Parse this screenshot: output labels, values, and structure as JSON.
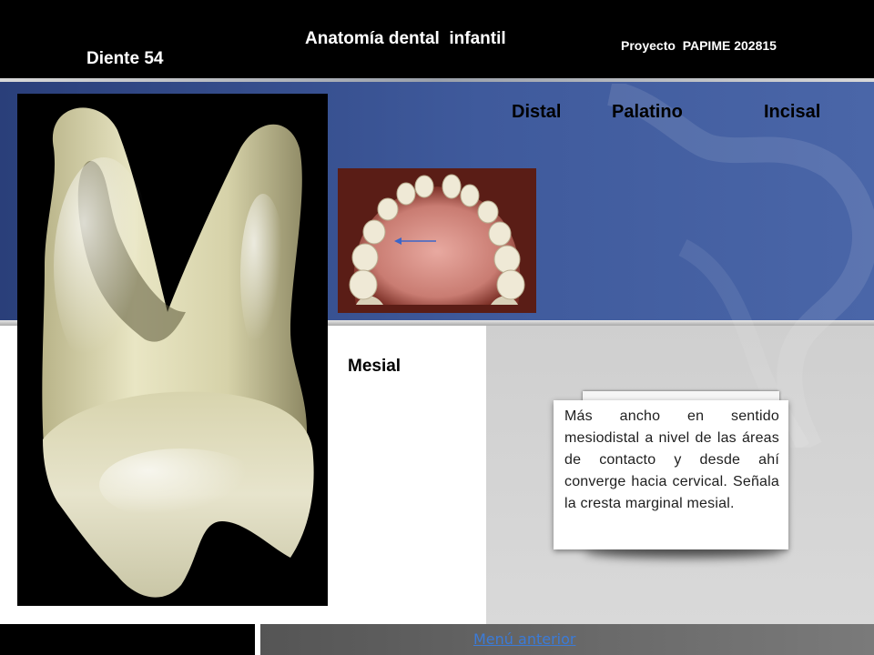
{
  "header": {
    "title": "Anatomía dental  infantil",
    "tooth": "Diente 54",
    "project": "Proyecto  PAPIME 202815"
  },
  "views": {
    "distal": "Distal",
    "palatino": "Palatino",
    "incisal": "Incisal"
  },
  "current_view": "Mesial",
  "description": "Más ancho en sentido mesiodistal a nivel de las áreas de contacto y desde ahí converge hacia cervical. Señala la cresta marginal mesial.",
  "footer": {
    "link": "Menú anterior"
  },
  "colors": {
    "header_bg": "#000000",
    "blue_band": "#3f5a9c",
    "link": "#3b7bd8"
  },
  "icons": {
    "tooth_photo": "tooth-mesial-photo",
    "mouth_photo": "palate-photo-with-arrow"
  }
}
